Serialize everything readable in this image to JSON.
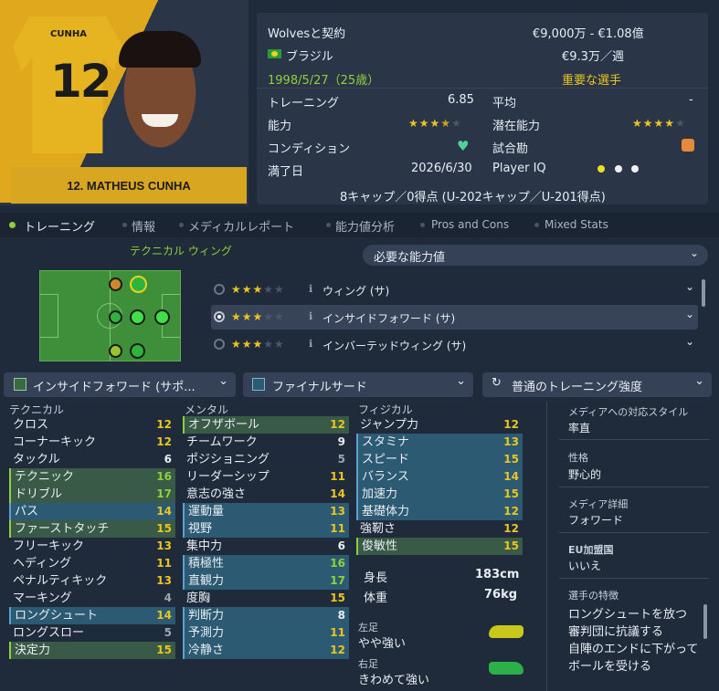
{
  "player": {
    "shirt_name": "CUNHA",
    "shirt_number": "12",
    "card_name": "12. MATHEUS CUNHA"
  },
  "info": {
    "contract": "Wolvesと契約",
    "value": "€9,000万 - €1.08億",
    "nationality": "ブラジル",
    "wage": "€9.3万／週",
    "dob": "1998/5/27（25歳）",
    "status": "重要な選手",
    "training_label": "トレーニング",
    "training_value": "6.85",
    "average_label": "平均",
    "average_value": "-",
    "ability_label": "能力",
    "potential_label": "潜在能力",
    "condition_label": "コンディション",
    "match_fitness_label": "試合勘",
    "expiry_label": "満了日",
    "expiry_value": "2026/6/30",
    "iq_label": "Player IQ",
    "caps": "8キャップ／0得点 (U-202キャップ／U-201得点)",
    "ability_stars": 3.5,
    "potential_stars": 4
  },
  "tabs": [
    "トレーニング",
    "情報",
    "メディカルレポート",
    "能力値分析",
    "Pros and Cons",
    "Mixed Stats"
  ],
  "position": {
    "title": "テクニカル ウィング",
    "required": "必要な能力値",
    "roles": [
      {
        "name": "ウィング (サ)",
        "stars": 3.5
      },
      {
        "name": "インサイドフォワード (サ)",
        "stars": 3.5
      },
      {
        "name": "インバーテッドウィング (サ)",
        "stars": 3.5
      }
    ]
  },
  "dropdowns": {
    "role": "インサイドフォワード (サポ...",
    "duty": "ファイナルサード",
    "intensity": "普通のトレーニング強度"
  },
  "technical": {
    "title": "テクニカル",
    "attrs": [
      {
        "n": "クロス",
        "v": "12"
      },
      {
        "n": "コーナーキック",
        "v": "12"
      },
      {
        "n": "タックル",
        "v": "6"
      },
      {
        "n": "テクニック",
        "v": "16"
      },
      {
        "n": "ドリブル",
        "v": "17"
      },
      {
        "n": "パス",
        "v": "14"
      },
      {
        "n": "ファーストタッチ",
        "v": "15"
      },
      {
        "n": "フリーキック",
        "v": "13"
      },
      {
        "n": "ヘディング",
        "v": "11"
      },
      {
        "n": "ペナルティキック",
        "v": "13"
      },
      {
        "n": "マーキング",
        "v": "4"
      },
      {
        "n": "ロングシュート",
        "v": "14"
      },
      {
        "n": "ロングスロー",
        "v": "5"
      },
      {
        "n": "決定力",
        "v": "15"
      }
    ]
  },
  "mental": {
    "title": "メンタル",
    "attrs": [
      {
        "n": "オフザボール",
        "v": "12"
      },
      {
        "n": "チームワーク",
        "v": "9"
      },
      {
        "n": "ポジショニング",
        "v": "5"
      },
      {
        "n": "リーダーシップ",
        "v": "11"
      },
      {
        "n": "意志の強さ",
        "v": "14"
      },
      {
        "n": "運動量",
        "v": "13"
      },
      {
        "n": "視野",
        "v": "11"
      },
      {
        "n": "集中力",
        "v": "6"
      },
      {
        "n": "積極性",
        "v": "16"
      },
      {
        "n": "直観力",
        "v": "17"
      },
      {
        "n": "度胸",
        "v": "15"
      },
      {
        "n": "判断力",
        "v": "8"
      },
      {
        "n": "予測力",
        "v": "11"
      },
      {
        "n": "冷静さ",
        "v": "12"
      }
    ]
  },
  "physical": {
    "title": "フィジカル",
    "attrs": [
      {
        "n": "ジャンプ力",
        "v": "12"
      },
      {
        "n": "スタミナ",
        "v": "13"
      },
      {
        "n": "スピード",
        "v": "15"
      },
      {
        "n": "バランス",
        "v": "14"
      },
      {
        "n": "加速力",
        "v": "15"
      },
      {
        "n": "基礎体力",
        "v": "12"
      },
      {
        "n": "強靭さ",
        "v": "12"
      },
      {
        "n": "俊敏性",
        "v": "15"
      }
    ]
  },
  "body": {
    "height_label": "身長",
    "height": "183cm",
    "weight_label": "体重",
    "weight": "76kg",
    "left_foot_label": "左足",
    "left_foot": "やや強い",
    "right_foot_label": "右足",
    "right_foot": "きわめて強い"
  },
  "side": {
    "media_label": "メディアへの対応スタイル",
    "media": "率直",
    "personality_label": "性格",
    "personality": "野心的",
    "media_detail_label": "メディア詳細",
    "media_detail": "フォワード",
    "eu_label": "EU加盟国",
    "eu": "いいえ",
    "traits_label": "選手の特徴",
    "traits": [
      "ロングシュートを放つ",
      "審判団に抗議する",
      "自陣のエンドに下がってボールを受ける"
    ]
  },
  "colors": {
    "accent": "#8fd13a",
    "gold": "#e9c521",
    "highlight": "#2c5a73"
  }
}
